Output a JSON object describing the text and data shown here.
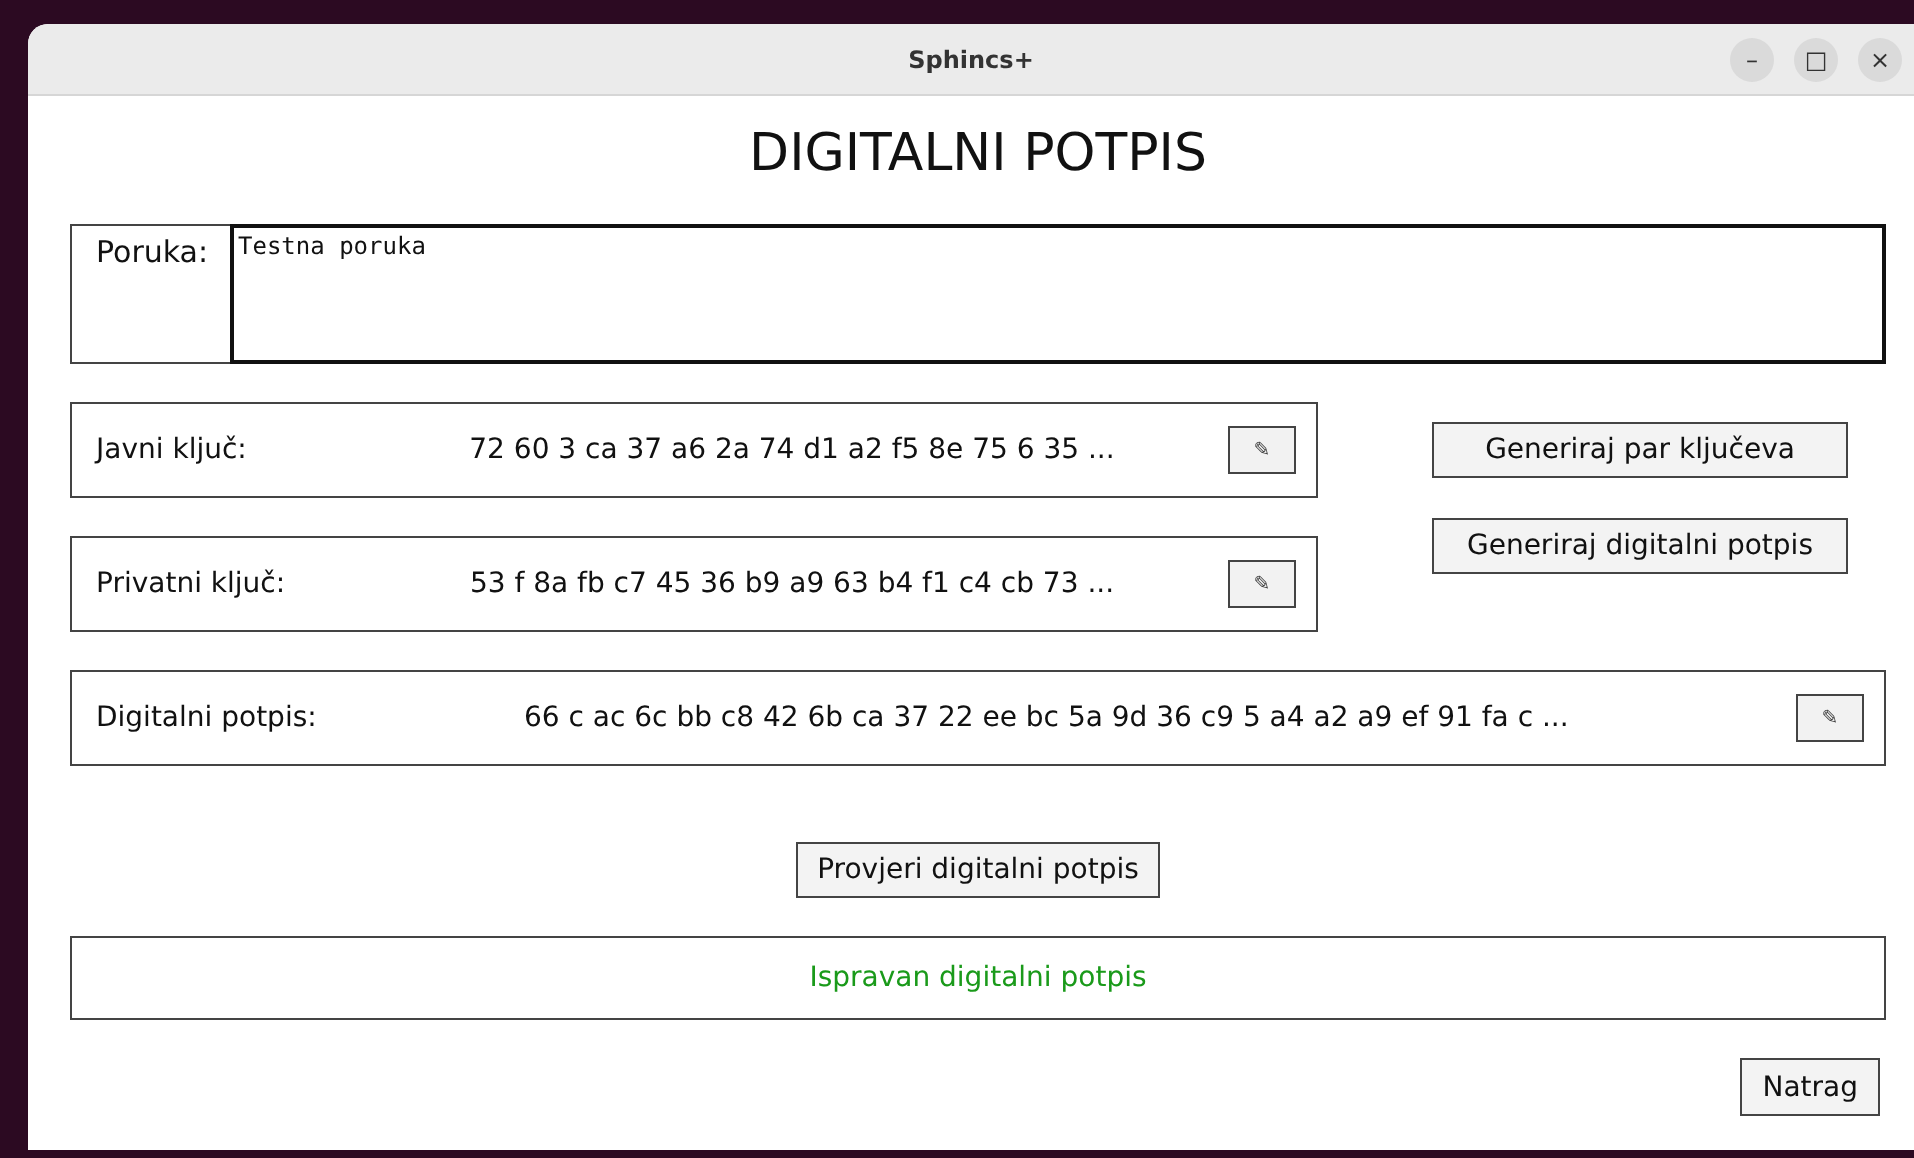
{
  "window": {
    "title": "Sphincs+",
    "controls": [
      "–",
      "□",
      "×"
    ]
  },
  "heading": "DIGITALNI POTPIS",
  "message": {
    "label": "Poruka:",
    "value": "Testna poruka"
  },
  "keys": [
    {
      "label": "Javni ključ:",
      "value": "72 60 3 ca 37 a6 2a 74 d1 a2 f5 8e 75 6 35 ...",
      "edit": "✎"
    },
    {
      "label": "Privatni ključ:",
      "value": "53 f 8a fb c7 45 36 b9 a9 63 b4 f1 c4 cb 73 ...",
      "edit": "✎"
    }
  ],
  "generate_buttons": [
    "Generiraj par ključeva",
    "Generiraj digitalni potpis"
  ],
  "signature": {
    "label": "Digitalni potpis:",
    "value": "66 c ac 6c bb c8 42 6b ca 37 22 ee bc 5a 9d 36 c9 5 a4 a2 a9 ef 91 fa c ...",
    "edit": "✎"
  },
  "verify_button": "Provjeri digitalni potpis",
  "result": {
    "text": "Ispravan digitalni potpis",
    "color": "#1a9a1a"
  },
  "back_button": "Natrag"
}
